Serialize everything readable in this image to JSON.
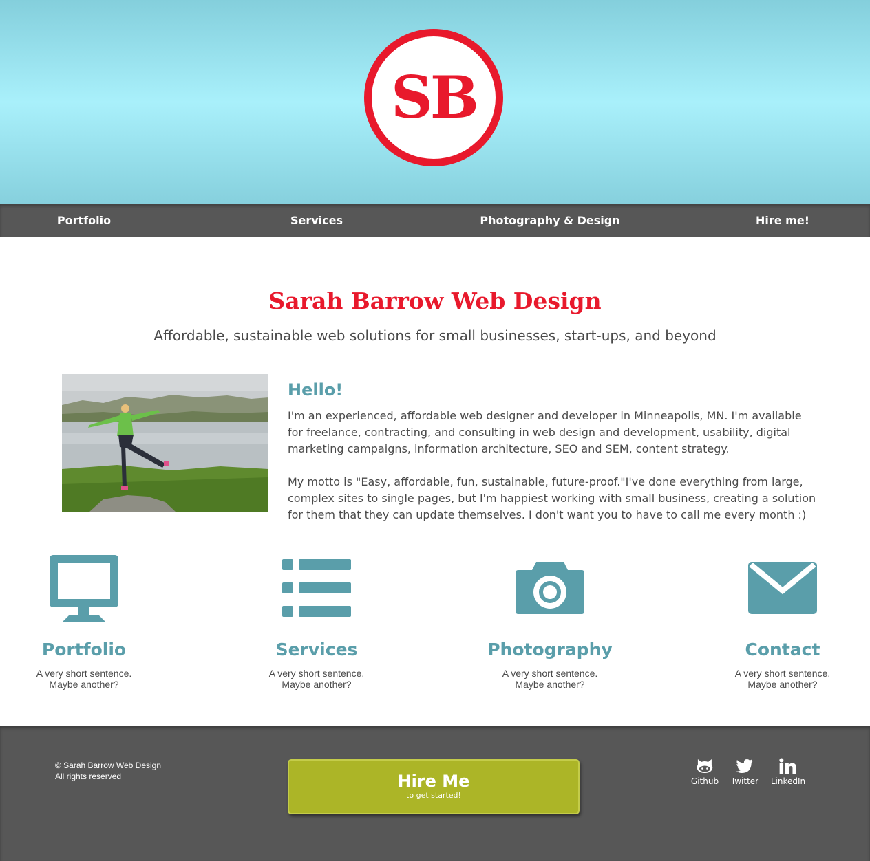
{
  "logo": {
    "text": "SB",
    "color": "#e8192c"
  },
  "nav": {
    "items": [
      {
        "label": "Portfolio"
      },
      {
        "label": "Services"
      },
      {
        "label": "Photography & Design"
      },
      {
        "label": "Hire me!"
      }
    ]
  },
  "intro": {
    "title": "Sarah Barrow Web Design",
    "tagline": "Affordable, sustainable web solutions for small businesses, start-ups, and beyond"
  },
  "hello": {
    "title": "Hello!",
    "paragraph1": "I'm an experienced, affordable web designer and developer in Minneapolis, MN. I'm available for freelance, contracting, and consulting in web design and development, usability, digital marketing campaigns, information architecture, SEO and SEM, content strategy.",
    "paragraph2": "My motto is \"Easy, affordable, fun, sustainable, future-proof.\"I've done everything from large, complex sites to single pages, but I'm happiest working with small business, creating a solution for them that they can update themselves. I don't want you to have to call me every month :)"
  },
  "features": [
    {
      "icon": "monitor-icon",
      "title": "Portfolio",
      "line1": "A very short sentence.",
      "line2": "Maybe another?"
    },
    {
      "icon": "list-icon",
      "title": "Services",
      "line1": "A very short sentence.",
      "line2": "Maybe another?"
    },
    {
      "icon": "camera-icon",
      "title": "Photography",
      "line1": "A very short sentence.",
      "line2": "Maybe another?"
    },
    {
      "icon": "envelope-icon",
      "title": "Contact",
      "line1": "A very short sentence.",
      "line2": "Maybe another?"
    }
  ],
  "footer": {
    "copyright_line1": "© Sarah Barrow Web Design",
    "copyright_line2": "All rights reserved",
    "hire_button": {
      "label": "Hire Me",
      "sublabel": "to get started!"
    },
    "social": [
      {
        "icon": "github-icon",
        "label": "Github"
      },
      {
        "icon": "twitter-icon",
        "label": "Twitter"
      },
      {
        "icon": "linkedin-icon",
        "label": "LinkedIn"
      }
    ]
  },
  "colors": {
    "brand_red": "#e8192c",
    "accent_teal": "#5a9eaa",
    "nav_gray": "#575757",
    "button_olive": "#acb527",
    "header_sky": "#a9f0fb"
  }
}
